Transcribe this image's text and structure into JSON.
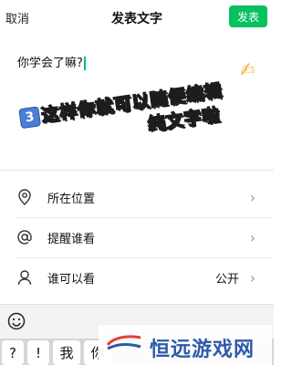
{
  "header": {
    "cancel_label": "取消",
    "title": "发表文字",
    "publish_label": "发表"
  },
  "compose": {
    "text": "你学会了嘛?"
  },
  "annotation": {
    "step_badge": "3",
    "line1": "这样你就可以随便编辑",
    "line2": "纯文字啦"
  },
  "options": [
    {
      "icon": "location-pin-icon",
      "label": "所在位置",
      "value": ""
    },
    {
      "icon": "at-mention-icon",
      "label": "提醒谁看",
      "value": ""
    },
    {
      "icon": "person-icon",
      "label": "谁可以看",
      "value": "公开"
    }
  ],
  "keyboard": {
    "keys": [
      "?",
      "!",
      "我",
      "你"
    ]
  },
  "watermark": {
    "text": "恒远游戏网"
  },
  "colors": {
    "accent": "#07c160",
    "badge": "#4b7fd6",
    "watermark": "#2e5aa8"
  }
}
